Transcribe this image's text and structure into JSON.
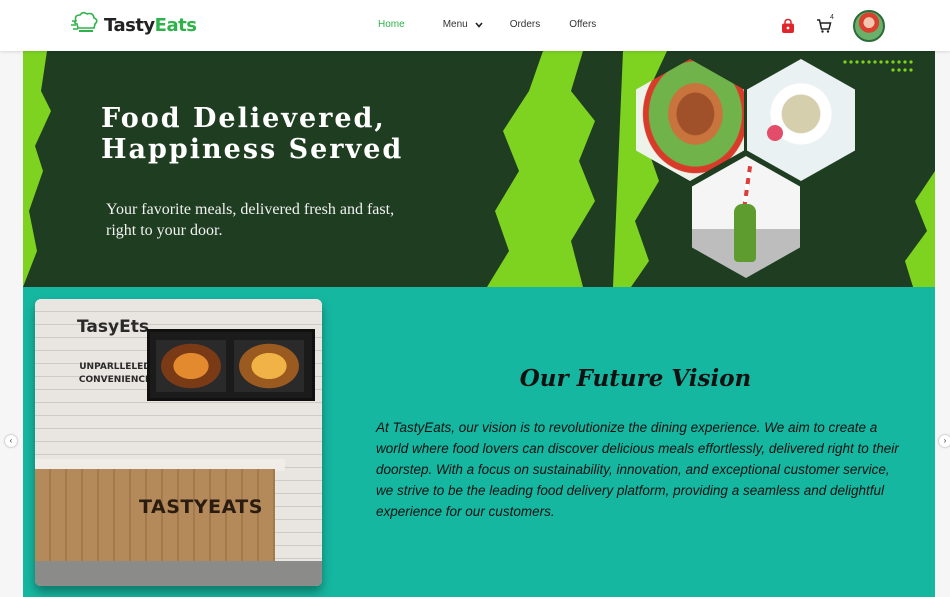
{
  "header": {
    "logo": {
      "text_dark": "Tasty",
      "text_green": "Eats"
    },
    "nav": [
      {
        "label": "Home",
        "active": true
      },
      {
        "label": "Menu",
        "has_dropdown": true
      },
      {
        "label": "Orders"
      },
      {
        "label": "Offers"
      }
    ],
    "icons": {
      "bag": "shopping-bag-icon",
      "cart": "cart-icon",
      "cart_count": "4",
      "avatar": "user-avatar"
    }
  },
  "hero": {
    "title_line1": "Food Delievered,",
    "title_line2": "Happiness Served",
    "subtitle": "Your favorite meals, delivered fresh and fast, right to your door."
  },
  "vision": {
    "title": "Our Future Vision",
    "text": "At TastyEats, our vision is to revolutionize the dining experience. We aim to create a world where food lovers can discover delicious meals effortlessly, delivered right to their doorstep. With a focus on sustainability, innovation, and exceptional customer service, we strive to be the leading food delivery platform, providing a seamless and delightful experience for our customers.",
    "image": {
      "sign_brand": "TasyEts",
      "sign_tagline": "UNPARLLELED CONVENIENCE",
      "counter_brand": "TASTYEATS"
    }
  },
  "carousel": {
    "prev": "‹",
    "next": "›"
  },
  "colors": {
    "accent": "#2fb24a",
    "hero_dark": "#1f3d21",
    "lime": "#7ed321",
    "teal": "#16b7a1"
  }
}
